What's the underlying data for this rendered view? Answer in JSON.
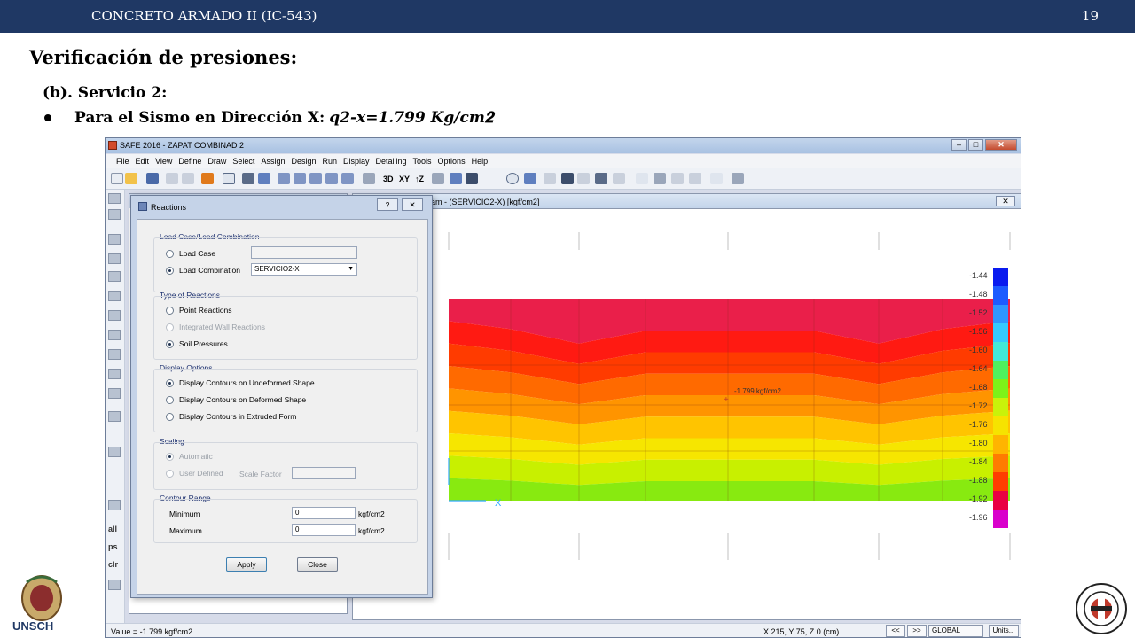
{
  "header": {
    "course": "CONCRETO ARMADO II (IC-543)",
    "page_number": "19"
  },
  "slide": {
    "title": "Verificación de presiones:",
    "subtitle": "(b). Servicio 2:",
    "bullet_text": "Para el Sismo en Dirección X: ",
    "bullet_math": "𝒒2-x=1.799 𝑲𝒈/𝒄𝒎𝟐"
  },
  "safe_window": {
    "title": "SAFE 2016 - ZAPAT COMBINAD 2",
    "menu": [
      "File",
      "Edit",
      "View",
      "Define",
      "Draw",
      "Select",
      "Assign",
      "Design",
      "Run",
      "Display",
      "Detailing",
      "Tools",
      "Options",
      "Help"
    ],
    "toolbar_text": {
      "3d": "3D",
      "xy": "XY",
      "tz": "↑Z"
    },
    "left_tool_text": [
      "all",
      "ps",
      "clr"
    ],
    "plot_title": "ram - (SERVICIO2-X)  [kgf/cm2]",
    "status_value": "Value = -1.799 kgf/cm2",
    "status_coords": "X 215,  Y 75,  Z 0  (cm)",
    "status_buttons": [
      "<<",
      ">>",
      "GLOBAL",
      "Units..."
    ]
  },
  "plot": {
    "annotation": "-1.799 kgf/cm2",
    "legend_labels": [
      "-1.44",
      "-1.48",
      "-1.52",
      "-1.56",
      "-1.60",
      "-1.64",
      "-1.68",
      "-1.72",
      "-1.76",
      "-1.80",
      "-1.84",
      "-1.88",
      "-1.92",
      "-1.96"
    ],
    "legend_colors": [
      "#0a1bef",
      "#1d5bff",
      "#2f96ff",
      "#35c9ff",
      "#43e8d8",
      "#50f05e",
      "#7df219",
      "#c9f20a",
      "#f6e300",
      "#ffb400",
      "#ff7b00",
      "#ff3d00",
      "#e90042",
      "#d900cc"
    ],
    "band_colors": [
      "#ea1f4a",
      "#ff1a12",
      "#ff3b00",
      "#ff6a00",
      "#ff9400",
      "#ffc400",
      "#f6e600",
      "#c8f000",
      "#88ea10"
    ]
  },
  "dialog": {
    "title": "Reactions",
    "group_load": "Load Case/Load Combination",
    "opt_load_case": "Load Case",
    "opt_load_combination": "Load Combination",
    "combo_value": "SERVICIO2-X",
    "group_type": "Type of Reactions",
    "opt_point": "Point Reactions",
    "opt_integrated": "Integrated Wall Reactions",
    "opt_soil": "Soil Pressures",
    "group_display": "Display Options",
    "opt_undeformed": "Display Contours on Undeformed Shape",
    "opt_deformed": "Display Contours on Deformed Shape",
    "opt_extruded": "Display Contours in Extruded Form",
    "group_scaling": "Scaling",
    "opt_automatic": "Automatic",
    "opt_user": "User Defined",
    "scale_factor": "Scale Factor",
    "group_contour": "Contour Range",
    "minimum": "Minimum",
    "maximum": "Maximum",
    "min_value": "0",
    "max_value": "0",
    "unit": "kgf/cm2",
    "apply": "Apply",
    "close": "Close"
  },
  "logos": {
    "left": "UNSCH"
  }
}
